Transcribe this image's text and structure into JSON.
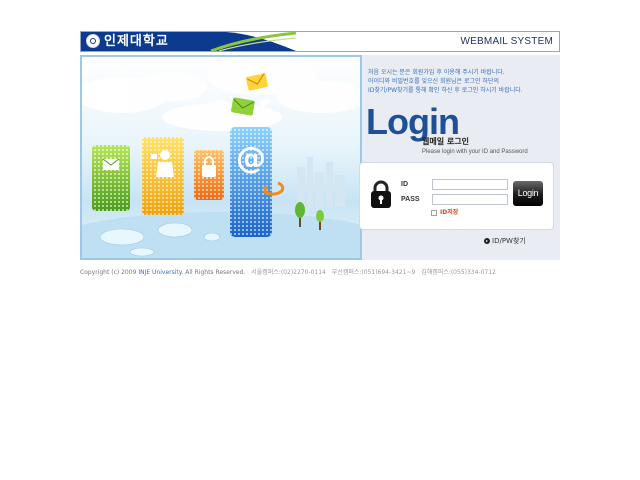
{
  "header": {
    "university_name": "인제대학교",
    "system_title": "WEBMAIL SYSTEM"
  },
  "icons": {
    "seal": "university-seal-icon",
    "lock": "padlock-icon",
    "arrow": "circle-arrow-icon"
  },
  "colors": {
    "brand_navy": "#0b3a8e",
    "brand_green": "#8cc63f",
    "login_blue": "#1f4f97",
    "notice_blue": "#3d6fb1",
    "save_orange": "#d24a20"
  },
  "notice": {
    "lines": [
      "처음 오시는 분은 회원가입 후 이용해 주시기 바랍니다.",
      "아이디와 비밀번호를 잊으신 회원님은 로그인 하단의",
      "ID찾기/PW찾기를 통해 확인 하신 후 로그인 하시기 바랍니다."
    ]
  },
  "login": {
    "heading": "Login",
    "subtitle_kr": "웹메일 로그인",
    "subtitle_en": "Please login with your ID and Password",
    "id_label": "ID",
    "pass_label": "PASS",
    "id_value": "",
    "pass_value": "",
    "button_label": "Login",
    "save_id_label": "ID저장",
    "find_link": "ID/PW찾기"
  },
  "footer": {
    "copyright": "Copyright (c) 2009",
    "university": "INJE University.",
    "rights": "All Rights Reserved.",
    "campuses": [
      "서울캠퍼스:(02)2270-0114",
      "부산캠퍼스:(051)694-3421~9",
      "김해캠퍼스:(055)334-0712"
    ]
  }
}
